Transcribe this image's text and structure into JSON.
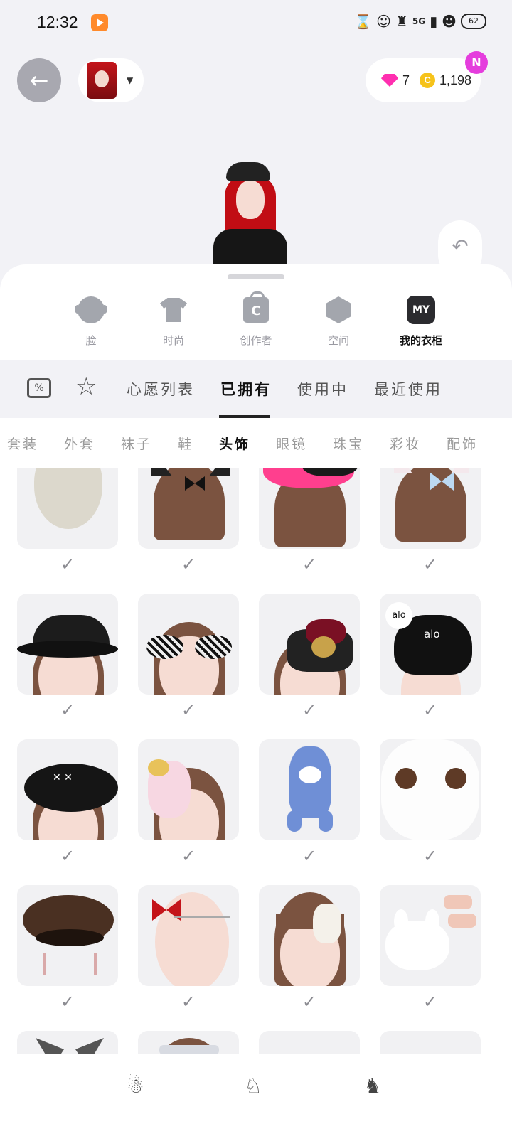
{
  "status_bar": {
    "time": "12:32",
    "network": "5G",
    "battery": "62"
  },
  "header": {
    "gems": "7",
    "coins": "1,198",
    "coin_symbol": "C",
    "notification_badge": "N"
  },
  "categories": [
    {
      "label": "脸",
      "icon": "face-icon",
      "active": false
    },
    {
      "label": "时尚",
      "icon": "shirt-icon",
      "active": false
    },
    {
      "label": "创作者",
      "icon": "creator-bag-icon",
      "active": false
    },
    {
      "label": "空间",
      "icon": "space-cube-icon",
      "active": false
    },
    {
      "label": "我的衣柜",
      "icon": "my-closet-icon",
      "badge": "MY",
      "active": true
    }
  ],
  "subtabs": [
    "心愿列表",
    "已拥有",
    "使用中",
    "最近使用"
  ],
  "active_subtab": "已拥有",
  "filters": [
    "套装",
    "外套",
    "袜子",
    "鞋",
    "头饰",
    "眼镜",
    "珠宝",
    "彩妆",
    "配饰"
  ],
  "active_filter": "头饰",
  "items": [
    {
      "name": "bare-face-item",
      "owned": true
    },
    {
      "name": "cat-ears-bow-item",
      "owned": true
    },
    {
      "name": "pink-beret-item",
      "owned": true
    },
    {
      "name": "white-cat-ears-bow-item",
      "owned": true
    },
    {
      "name": "black-wide-hat-item",
      "owned": true
    },
    {
      "name": "zebra-sunglasses-item",
      "owned": true
    },
    {
      "name": "lace-mini-hat-item",
      "owned": true
    },
    {
      "name": "alo-bucket-hat-item",
      "owned": true,
      "brand_badge": "alo",
      "brand_text": "alo"
    },
    {
      "name": "bow-beret-item",
      "owned": true
    },
    {
      "name": "lolita-headdress-item",
      "owned": true
    },
    {
      "name": "shark-hood-item",
      "owned": true
    },
    {
      "name": "white-face-item",
      "owned": true
    },
    {
      "name": "brown-beret-item",
      "owned": true
    },
    {
      "name": "butterfly-chain-item",
      "owned": true
    },
    {
      "name": "flower-clip-item",
      "owned": true
    },
    {
      "name": "bunny-hat-item",
      "owned": true
    },
    {
      "name": "bat-wings-item",
      "owned": false
    },
    {
      "name": "silver-tiara-item",
      "owned": false
    },
    {
      "name": "empty-slot-1",
      "owned": false
    },
    {
      "name": "empty-slot-2",
      "owned": false
    }
  ],
  "icons": {
    "back": "←",
    "undo": "↶",
    "star": "☆",
    "check": "✓",
    "caret": "▼"
  },
  "colors": {
    "accent_badge": "#e53ddd",
    "gem": "#ff2fb0",
    "coin": "#f6c31b"
  }
}
